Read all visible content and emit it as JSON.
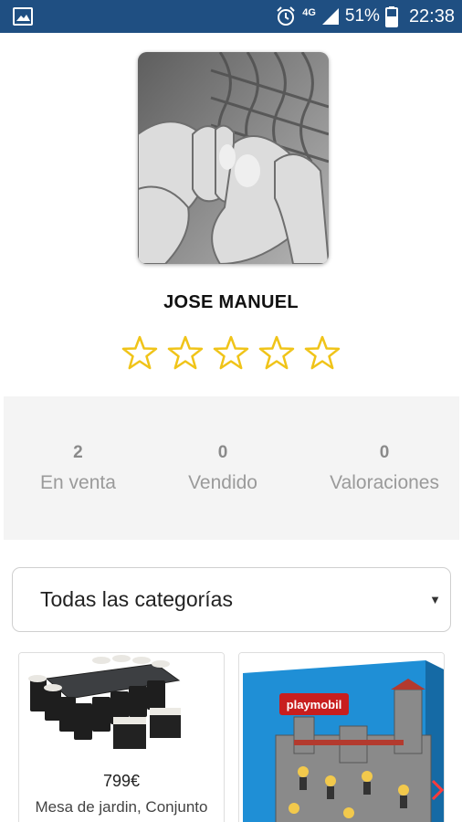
{
  "status_bar": {
    "network": "4G",
    "battery": "51%",
    "time": "22:38",
    "icons": [
      "image-icon",
      "alarm-icon",
      "signal-icon",
      "battery-icon"
    ]
  },
  "profile": {
    "name": "JOSE MANUEL",
    "rating": 0,
    "rating_max": 5,
    "star_color": "#f0c419"
  },
  "stats": [
    {
      "value": "2",
      "label": "En venta"
    },
    {
      "value": "0",
      "label": "Vendido"
    },
    {
      "value": "0",
      "label": "Valoraciones"
    }
  ],
  "category_select": {
    "selected": "Todas las categorías"
  },
  "products": [
    {
      "price": "799€",
      "title": "Mesa de jardin, Conjunto"
    },
    {
      "price": "",
      "title": "",
      "brand": "playmobil"
    }
  ],
  "colors": {
    "status_bar": "#1f4f82",
    "stats_bg": "#f4f4f4"
  }
}
